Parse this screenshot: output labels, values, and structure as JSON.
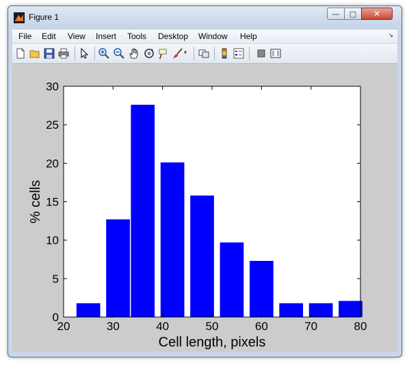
{
  "window": {
    "title": "Figure 1"
  },
  "menu": [
    "File",
    "Edit",
    "View",
    "Insert",
    "Tools",
    "Desktop",
    "Window",
    "Help"
  ],
  "controls": {
    "minimize": "—",
    "maximize": "□",
    "close": "✕"
  },
  "toolbar_icons": [
    "new-figure-icon",
    "open-file-icon",
    "save-icon",
    "print-icon",
    "edit-plot-icon",
    "zoom-in-icon",
    "zoom-out-icon",
    "pan-icon",
    "rotate-3d-icon",
    "data-cursor-icon",
    "brush-icon",
    "link-plot-icon",
    "insert-colorbar-icon",
    "insert-legend-icon",
    "hide-plot-tools-icon",
    "show-plot-tools-icon"
  ],
  "colors": {
    "bar": "#0000ff",
    "figure_bg": "#cccccc",
    "axes_bg": "#ffffff"
  },
  "chart_data": {
    "type": "bar",
    "x": [
      25,
      31,
      36,
      42,
      48,
      54,
      60,
      66,
      72,
      78
    ],
    "values": [
      1.8,
      12.7,
      27.6,
      20.1,
      15.8,
      9.7,
      7.3,
      1.8,
      1.8,
      2.1
    ],
    "xlabel": "Cell length, pixels",
    "ylabel": "% cells",
    "xlim": [
      20,
      80
    ],
    "ylim": [
      0,
      30
    ],
    "xticks": [
      "20",
      "30",
      "40",
      "50",
      "60",
      "70",
      "80"
    ],
    "yticks": [
      "0",
      "5",
      "10",
      "15",
      "20",
      "25",
      "30"
    ],
    "grid": false
  }
}
